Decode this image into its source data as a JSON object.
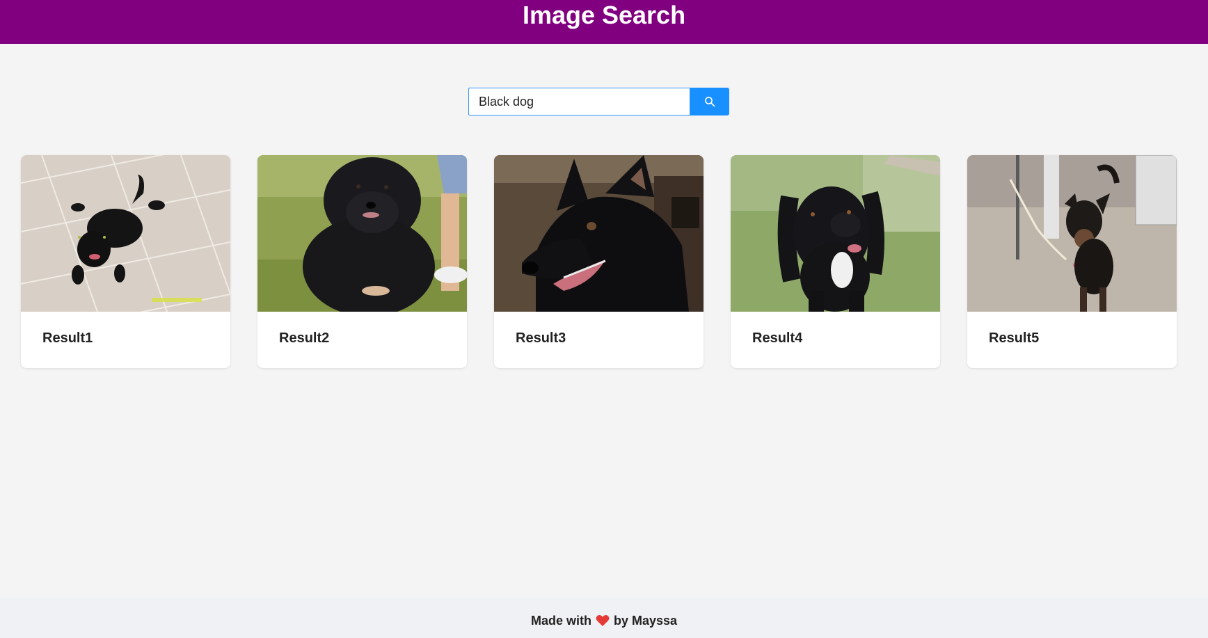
{
  "header": {
    "title": "Image Search",
    "background": "#800080"
  },
  "search": {
    "value": "Black dog",
    "button_icon": "search-icon",
    "accent": "#1990ff"
  },
  "results": [
    {
      "title": "Result1",
      "image": "small black dog lying on tile floor"
    },
    {
      "title": "Result2",
      "image": "fluffy black puppy sitting on grass"
    },
    {
      "title": "Result3",
      "image": "black shepherd dog head close-up"
    },
    {
      "title": "Result4",
      "image": "black hound dog with white chest on grass"
    },
    {
      "title": "Result5",
      "image": "black and tan dog on leash indoors"
    }
  ],
  "footer": {
    "text_before": "Made with",
    "heart_icon": "heart-icon",
    "text_after": "by Mayssa"
  }
}
